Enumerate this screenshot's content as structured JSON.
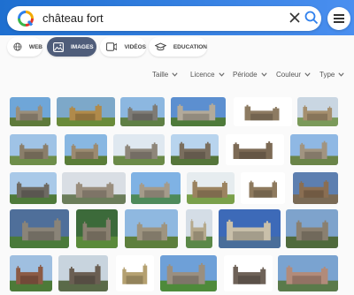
{
  "search": {
    "query": "château fort"
  },
  "tabs": [
    {
      "label": "WEB",
      "icon": "globe-icon"
    },
    {
      "label": "IMAGES",
      "icon": "image-icon",
      "active": true
    },
    {
      "label": "VIDÉOS",
      "icon": "video-icon"
    },
    {
      "label": "EDUCATION",
      "icon": "graduation-cap-icon"
    }
  ],
  "filters": [
    "Taille",
    "Licence",
    "Période",
    "Couleur",
    "Type"
  ],
  "colors": {
    "topbar": "#2b7be0",
    "active_tab": "#4f5d7a",
    "logo_ring": [
      "#f2a900",
      "#e4342b",
      "#3bb54a",
      "#2f80ed"
    ]
  },
  "results": [
    {
      "sky": "#6fa6d8",
      "ground": "#5e7a3a",
      "stone": "#9a8e7a"
    },
    {
      "sky": "#7da8c9",
      "ground": "#6a8b3a",
      "stone": "#b08a4a"
    },
    {
      "sky": "#8cb7e0",
      "ground": "#5f7f45",
      "stone": "#7e7b75"
    },
    {
      "sky": "#5c8fd0",
      "ground": "#4e7a3a",
      "stone": "#b3aa9a"
    },
    {
      "sky": "#ffffff",
      "ground": "#ffffff",
      "stone": "#8d7b62"
    },
    {
      "sky": "#c9d6e2",
      "ground": "#7b9a5a",
      "stone": "#a58f6e"
    },
    {
      "sky": "#9fc3e6",
      "ground": "#6e8e4a",
      "stone": "#8a7e6a"
    },
    {
      "sky": "#88b7e2",
      "ground": "#5a7d38",
      "stone": "#9c8a70"
    },
    {
      "sky": "#dfe8f0",
      "ground": "#6b8a48",
      "stone": "#8e867a"
    },
    {
      "sky": "#b8d4ee",
      "ground": "#55753a",
      "stone": "#7a6e5e"
    },
    {
      "sky": "#ffffff",
      "ground": "#ffffff",
      "stone": "#7c6a55"
    },
    {
      "sky": "#8fb8e4",
      "ground": "#6a8448",
      "stone": "#a19480"
    },
    {
      "sky": "#a9c9e8",
      "ground": "#4f7a3a",
      "stone": "#6e6a62"
    },
    {
      "sky": "#d9dee4",
      "ground": "#6b7d5a",
      "stone": "#9a8e7e"
    },
    {
      "sky": "#7fb2e4",
      "ground": "#4e8a5a",
      "stone": "#a59b8a"
    },
    {
      "sky": "#e6ecef",
      "ground": "#7aa04a",
      "stone": "#9b8360"
    },
    {
      "sky": "#ffffff",
      "ground": "#ffffff",
      "stone": "#8e7a5e"
    },
    {
      "sky": "#5d7fb0",
      "ground": "#7a6a55",
      "stone": "#8a6e52"
    },
    {
      "sky": "#4f6f9a",
      "ground": "#4a7a3a",
      "stone": "#8a8478"
    },
    {
      "sky": "#3c6a3a",
      "ground": "#5a8a3a",
      "stone": "#8a8070"
    },
    {
      "sky": "#8fb8e0",
      "ground": "#5d7f3d",
      "stone": "#9e9480"
    },
    {
      "sky": "#d4dde6",
      "ground": "#5b8848",
      "stone": "#b5a98c"
    },
    {
      "sky": "#3d6ab8",
      "ground": "#4a6e9a",
      "stone": "#c9c0aa"
    },
    {
      "sky": "#7ea3cc",
      "ground": "#4f6a3c",
      "stone": "#8a8070"
    },
    {
      "sky": "#9fbfe0",
      "ground": "#4d7a38",
      "stone": "#8b5a45"
    },
    {
      "sky": "#c8d4de",
      "ground": "#5a6a48",
      "stone": "#6a5e52"
    },
    {
      "sky": "#ffffff",
      "ground": "#ffffff",
      "stone": "#b4a070"
    },
    {
      "sky": "#6ea0d8",
      "ground": "#4e8a3a",
      "stone": "#9a8f80"
    },
    {
      "sky": "#ffffff",
      "ground": "#ffffff",
      "stone": "#6e6258"
    },
    {
      "sky": "#7aa3d0",
      "ground": "#5a7a4a",
      "stone": "#b28b7a"
    }
  ]
}
